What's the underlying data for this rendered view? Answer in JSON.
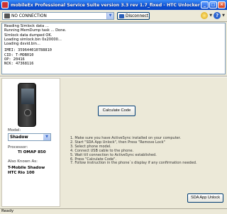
{
  "window": {
    "title": "mobileEx Professional Service Suite version 3.3 rev 1.7_fixed - HTC Unlocker",
    "minimize": "_",
    "maximize": "□",
    "close": "×"
  },
  "toolbar": {
    "connection_value": "NO CONNECTION",
    "disconnect_label": "Disconnect"
  },
  "log": {
    "lines": [
      "Reading Simlock data ...",
      "Running MemDump task ... Done.",
      "Simlock data dumped OK.",
      "Loading simlock.bin 0x20000...",
      "Loading dxvid.bin..."
    ],
    "imei": "IMEI: 359644010788810",
    "cid": "CID: T-MOB010",
    "op": "OP: 20416",
    "nck": "NCK: 47368116"
  },
  "left": {
    "model_label": "Model:",
    "model_value": "Shadow",
    "processor_label": "Processor:",
    "processor_value": "TI OMAP 850",
    "aka_label": "Also Known As:",
    "aka_lines": [
      "T-Mobile Shadow",
      "HTC Rio 100"
    ]
  },
  "right": {
    "calculate_label": "Calculate Code",
    "instructions": [
      "1. Make sure you have ActiveSync installed on your computer.",
      "2. Start \"SDA App Unlock\", then Press \"Remove Lock\"",
      "3. Select phone model.",
      "4. Connect USB cable to the phone.",
      "5. Wait till connection to ActiveSync established.",
      "6. Press \"Calculate Code\".",
      "7. Follow instruction in the phone`s display if any confirmation needed."
    ],
    "sda_label": "SDA App Unlock"
  },
  "status": {
    "text": "Ready"
  }
}
